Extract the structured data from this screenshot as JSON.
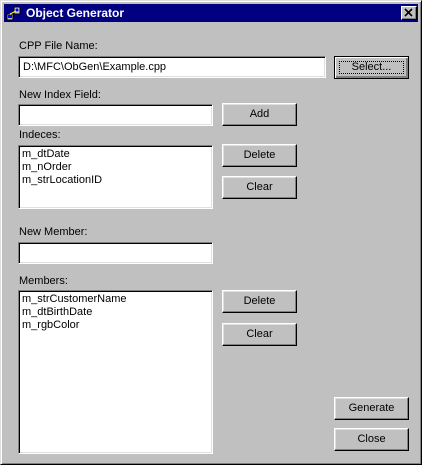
{
  "window": {
    "title": "Object Generator"
  },
  "cpp": {
    "label": "CPP File Name:",
    "value": "D:\\MFC\\ObGen\\Example.cpp",
    "select_label": "Select..."
  },
  "index_field": {
    "label": "New Index Field:",
    "value": "",
    "add_label": "Add"
  },
  "indeces": {
    "label": "Indeces:",
    "items": [
      "m_dtDate",
      "m_nOrder",
      "m_strLocationID"
    ],
    "delete_label": "Delete",
    "clear_label": "Clear"
  },
  "new_member": {
    "label": "New Member:",
    "value": ""
  },
  "members": {
    "label": "Members:",
    "items": [
      "m_strCustomerName",
      "m_dtBirthDate",
      "m_rgbColor"
    ],
    "delete_label": "Delete",
    "clear_label": "Clear"
  },
  "actions": {
    "generate_label": "Generate",
    "close_label": "Close"
  },
  "icons": {
    "app": "generator-app-icon",
    "close": "close-icon"
  },
  "colors": {
    "titlebar": "#000080",
    "face": "#c0c0c0"
  }
}
